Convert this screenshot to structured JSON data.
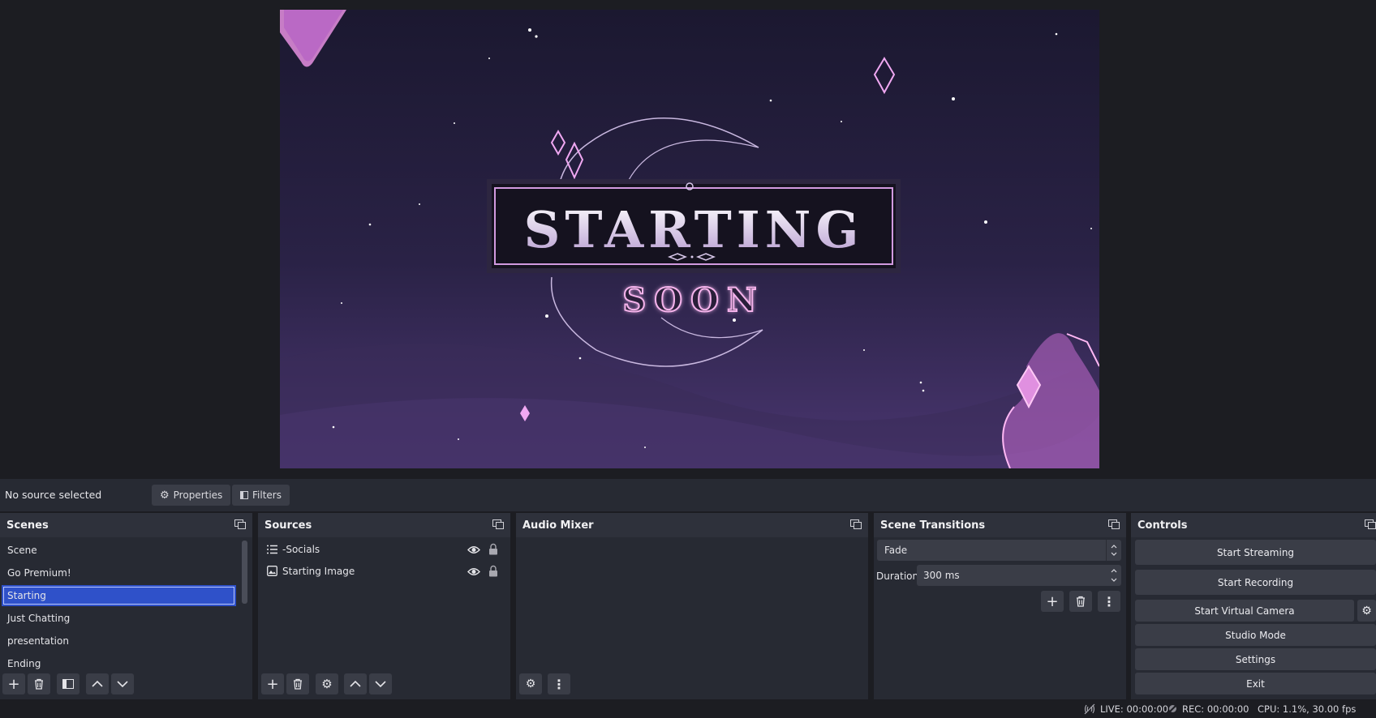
{
  "preview": {
    "overlay_title": "STARTING",
    "overlay_subtitle": "SOON"
  },
  "context_bar": {
    "selection_text": "No source selected",
    "properties_label": "Properties",
    "filters_label": "Filters"
  },
  "scenes": {
    "title": "Scenes",
    "items": [
      {
        "label": "Scene"
      },
      {
        "label": "Go Premium!"
      },
      {
        "label": "Starting"
      },
      {
        "label": "Just Chatting"
      },
      {
        "label": "presentation"
      },
      {
        "label": "Ending"
      }
    ],
    "selected": "Starting"
  },
  "sources": {
    "title": "Sources",
    "items": [
      {
        "label": "-Socials",
        "icon": "list-icon"
      },
      {
        "label": "Starting Image",
        "icon": "image-icon"
      }
    ]
  },
  "audio_mixer": {
    "title": "Audio Mixer"
  },
  "transitions": {
    "title": "Scene Transitions",
    "selected": "Fade",
    "duration_label": "Duration",
    "duration_value": "300 ms"
  },
  "controls": {
    "title": "Controls",
    "start_streaming": "Start Streaming",
    "start_recording": "Start Recording",
    "start_virtual_camera": "Start Virtual Camera",
    "studio_mode": "Studio Mode",
    "settings": "Settings",
    "exit": "Exit"
  },
  "status": {
    "live": "LIVE: 00:00:00",
    "rec": "REC: 00:00:00",
    "cpu": "CPU: 1.1%, 30.00 fps"
  },
  "colors": {
    "selection": "#2f51c9",
    "panel": "#272a33",
    "accent_pink": "#e8a2f0"
  }
}
